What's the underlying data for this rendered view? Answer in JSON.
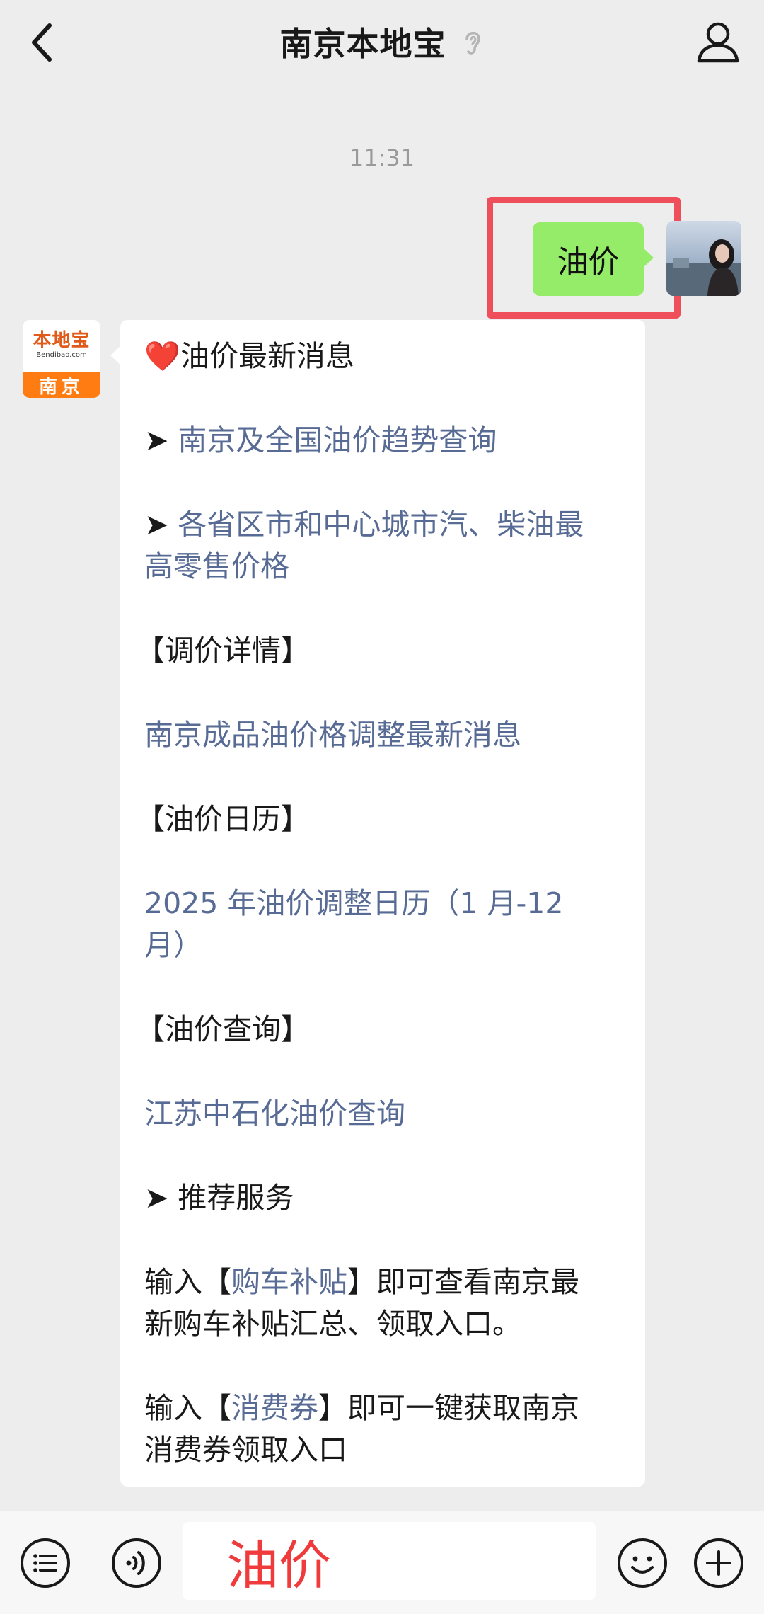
{
  "header": {
    "title": "南京本地宝"
  },
  "chat": {
    "timestamp": "11:31",
    "my_message": "油价",
    "bot_avatar": {
      "logo": "本地宝",
      "sub": "Bendibao.com",
      "city": "南京"
    },
    "reply": {
      "heading_icon": "❤️",
      "heading": "油价最新消息",
      "arrow": "➤",
      "link_trend": "南京及全国油价趋势查询",
      "link_prices": "各省区市和中心城市汽、柴油最高零售价格",
      "link_prices_l1": "各省区市和中心城市汽、柴油最",
      "link_prices_l2": "高零售价格",
      "section_adjust": "【调价详情】",
      "link_adjust": "南京成品油价格调整最新消息",
      "section_calendar": "【油价日历】",
      "link_calendar_l1": "2025 年油价调整日历（1 月-12",
      "link_calendar_l2": "月）",
      "section_query": "【油价查询】",
      "link_query": "江苏中石化油价查询",
      "recommend": "推荐服务",
      "subsidy_prefix": "输入【",
      "subsidy_kw": "购车补贴",
      "subsidy_suffix_l1": "】即可查看南京最",
      "subsidy_l2": "新购车补贴汇总、领取入口。",
      "coupon_prefix": "输入【",
      "coupon_kw": "消费券",
      "coupon_suffix_l1": "】即可一键获取南京",
      "coupon_l2": "消费券领取入口"
    }
  },
  "input_bar": {
    "value": "油价"
  },
  "colors": {
    "link": "#576b95",
    "my_bubble": "#95ec69",
    "highlight": "#ef4f5b",
    "input_text": "#ef3b3b"
  },
  "icons": [
    "back-chevron-icon",
    "ear-icon",
    "profile-icon",
    "menu-list-icon",
    "voice-icon",
    "emoji-icon",
    "plus-icon"
  ]
}
